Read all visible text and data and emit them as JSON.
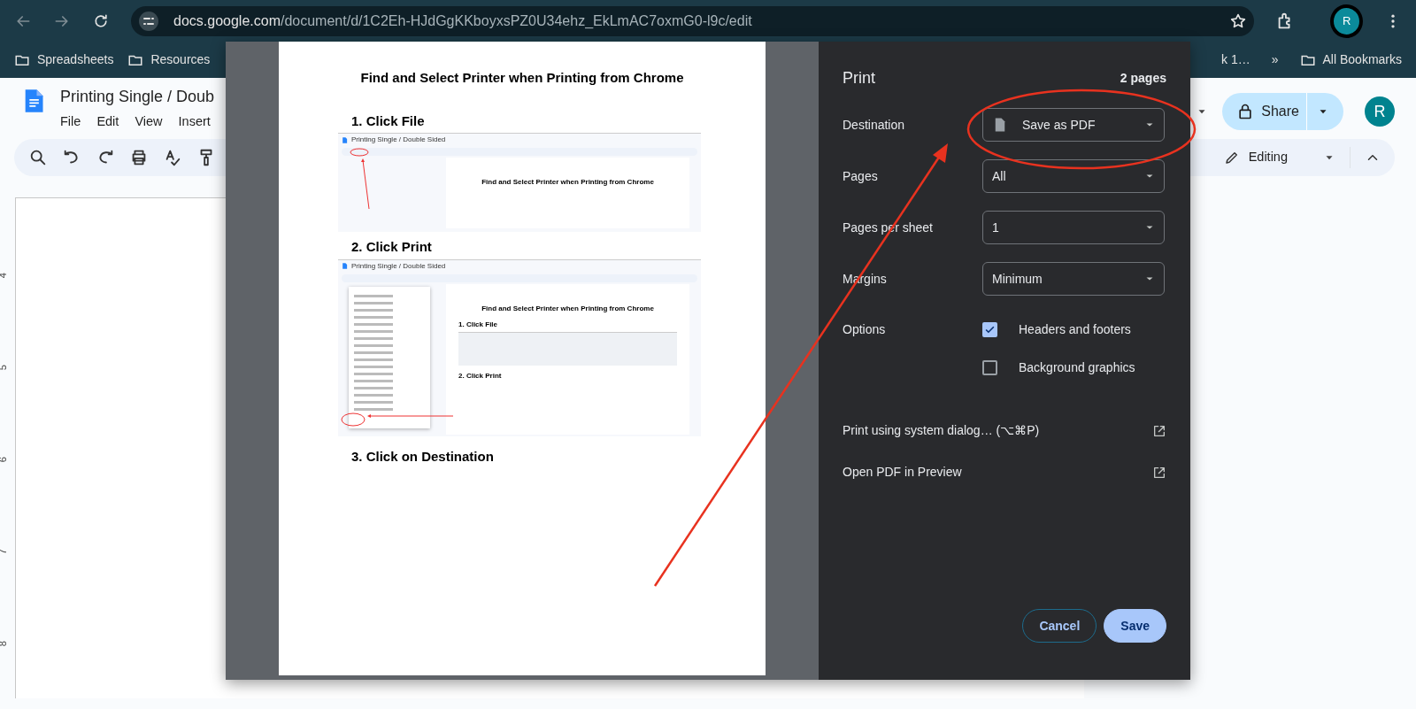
{
  "browser": {
    "url_host": "docs.google.com",
    "url_path": "/document/d/1C2Eh-HJdGgKKboyxsPZ0U34ehz_EkLmAC7oxmG0-l9c/edit",
    "avatar": "R"
  },
  "bookmarks": [
    {
      "label": "Spreadsheets"
    },
    {
      "label": "Resources"
    },
    {
      "label": "k 1…"
    }
  ],
  "bookmarks_overflow": "»",
  "all_bookmarks": "All Bookmarks",
  "doc": {
    "title": "Printing Single / Doub",
    "menus": [
      "File",
      "Edit",
      "View",
      "Insert"
    ],
    "share": "Share",
    "avatar": "R",
    "mode": "Editing",
    "ruler_marks": [
      "4",
      "5",
      "6",
      "7",
      "8"
    ]
  },
  "preview": {
    "heading": "Find and Select Printer when Printing from Chrome",
    "steps": [
      {
        "label": "1. Click File",
        "shot": {
          "kind": "file-step",
          "title": "Printing Single / Double Sided",
          "heading": "Find and Select Printer when Printing from Chrome"
        }
      },
      {
        "label": "2. Click Print",
        "shot": {
          "kind": "print-step",
          "title": "Printing Single / Double Sided",
          "heading": "Find and Select Printer when Printing from Chrome",
          "steps": [
            "1. Click File",
            "2. Click Print"
          ]
        }
      },
      {
        "label": "3. Click on Destination"
      }
    ]
  },
  "print": {
    "title": "Print",
    "pages_count": "2 pages",
    "settings": [
      {
        "label": "Destination",
        "value": "Save as PDF",
        "kind": "destination"
      },
      {
        "label": "Pages",
        "value": "All",
        "kind": "select"
      },
      {
        "label": "Pages per sheet",
        "value": "1",
        "kind": "select"
      },
      {
        "label": "Margins",
        "value": "Minimum",
        "kind": "select"
      }
    ],
    "options_label": "Options",
    "options": [
      {
        "label": "Headers and footers",
        "checked": true
      },
      {
        "label": "Background graphics",
        "checked": false
      }
    ],
    "links": [
      "Print using system dialog… (⌥⌘P)",
      "Open PDF in Preview"
    ],
    "buttons": [
      {
        "label": "Cancel",
        "kind": "secondary"
      },
      {
        "label": "Save",
        "kind": "primary"
      }
    ]
  }
}
